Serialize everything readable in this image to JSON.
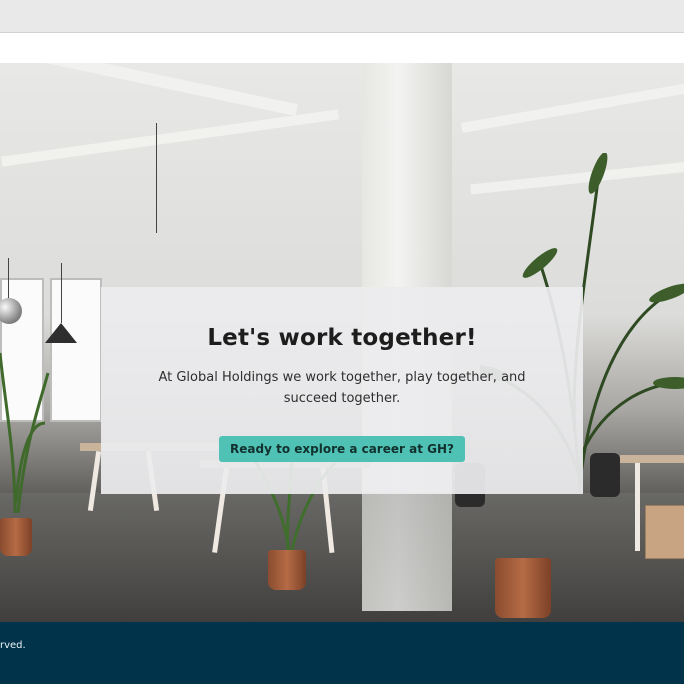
{
  "hero": {
    "title": "Let's work together!",
    "description": "At Global Holdings we work together, play together, and succeed together.",
    "cta_label": "Ready to explore a career at GH?"
  },
  "footer": {
    "text": "rved."
  },
  "colors": {
    "cta_background": "#4fc2b5",
    "footer_background": "#01344a",
    "top_bar": "#e9e9e9"
  }
}
